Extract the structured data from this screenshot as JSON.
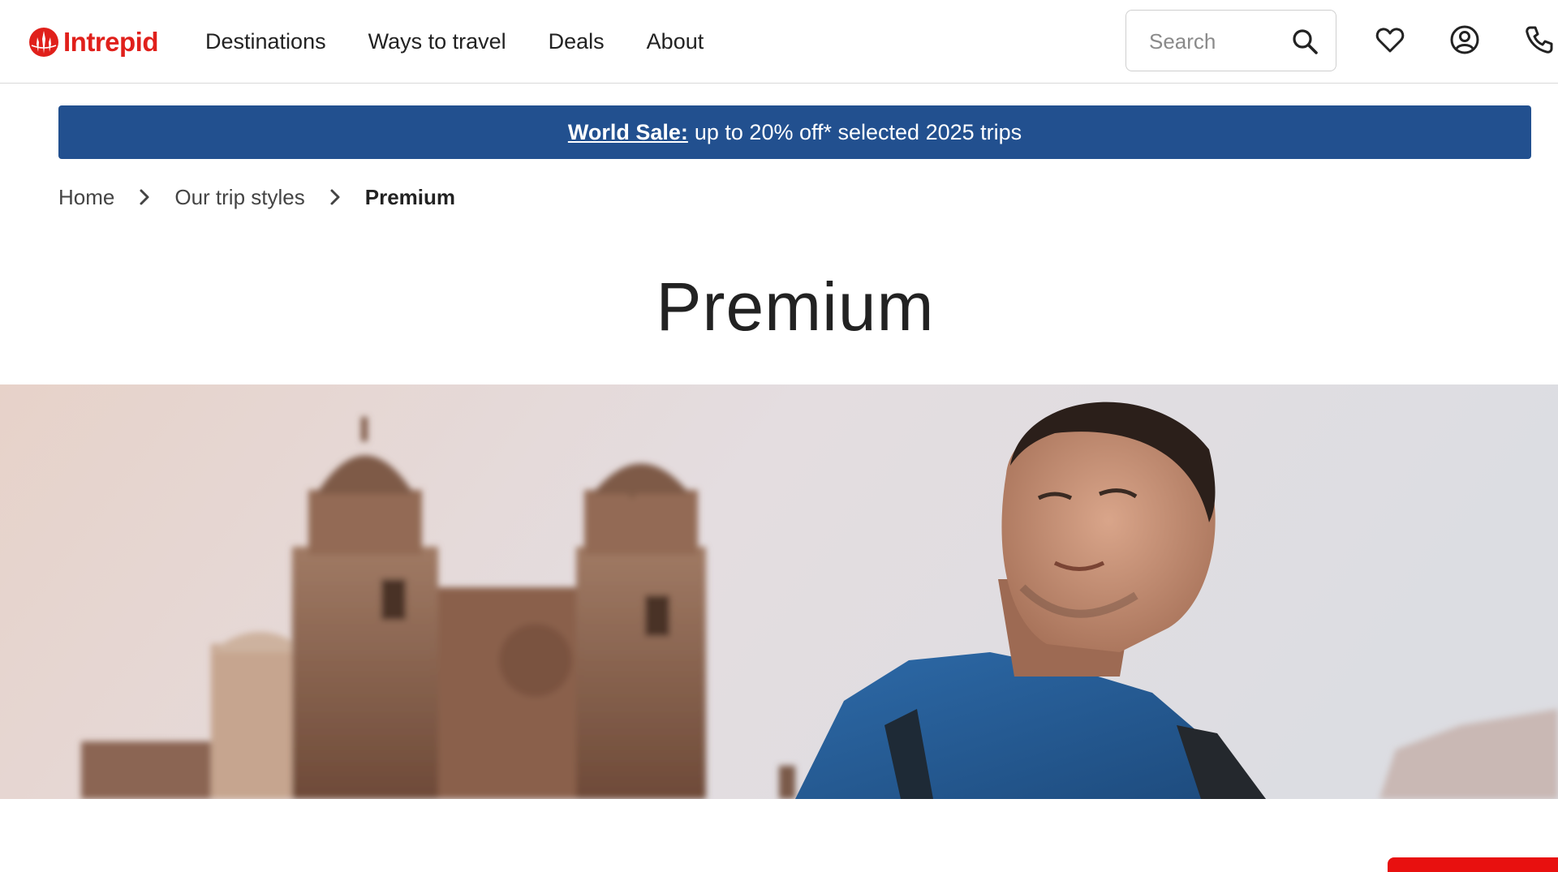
{
  "brand": {
    "name": "Intrepid",
    "color": "#e0201b"
  },
  "nav": {
    "items": [
      {
        "label": "Destinations"
      },
      {
        "label": "Ways to travel"
      },
      {
        "label": "Deals"
      },
      {
        "label": "About"
      }
    ]
  },
  "search": {
    "placeholder": "Search"
  },
  "header_icons": [
    "search-icon",
    "heart-icon",
    "account-icon",
    "phone-icon"
  ],
  "promo": {
    "link_label": "World Sale:",
    "text": "up to 20% off* selected 2025 trips",
    "background": "#22508f"
  },
  "breadcrumb": {
    "items": [
      {
        "label": "Home"
      },
      {
        "label": "Our trip styles"
      }
    ],
    "current": "Premium"
  },
  "page": {
    "title": "Premium"
  }
}
